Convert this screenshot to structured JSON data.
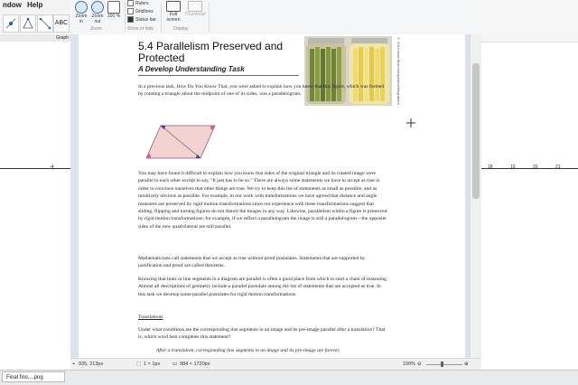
{
  "geo_left": {
    "menu": [
      "ndow",
      "Help"
    ],
    "tool_abc": "ABC",
    "panel_header": "Graph"
  },
  "paint": {
    "ribbon": {
      "zoom_in": "Zoom in",
      "zoom_out": "Zoom out",
      "percent": "100 %",
      "zoom_group": "Zoom",
      "rulers": "Rulers",
      "gridlines": "Gridlines",
      "status_bar": "Status bar",
      "show_hide_group": "Show or hide",
      "full_screen": "Full screen",
      "thumbnail": "Thumbnail",
      "display_group": "Display"
    },
    "status": {
      "cursor_pos": "935, 213px",
      "selection_size": "1 × 1px",
      "image_size": "984 × 1720px",
      "zoom": "100%"
    }
  },
  "document": {
    "title": "5.4 Parallelism Preserved and Protected",
    "subtitle": "A Develop Understanding Task",
    "photo_credit": "© 2013 www.flickr.com/photos/thegrabers",
    "paragraphs": [
      "In a previous task, How Do You Know That, you were asked to explain how you knew that this figure, which was formed by rotating a triangle about the midpoint of one of its sides, was a parallelogram.",
      "You may have found it difficult to explain how you know that sides of the original triangle and its rotated image were parallel to each other except to say, \"It just has to be so.\" There are always some statements we have to accept as true in order to convince ourselves that other things are true. We try to keep this list of statements as small as possible, and as intuitively obvious as possible. For example, in our work with transformations we have agreed that distance and angle measures are preserved by rigid motion transformations since our experience with these transformations suggest that sliding, flipping and turning figures do not distort the images in any way. Likewise, parallelism within a figure is preserved by rigid motion transformations: for example, if we reflect a parallelogram the image is still a parallelogram—the opposite sides of the new quadrilateral are still parallel.",
      "Mathematicians call statements that we accept as true without proof postulates. Statements that are supported by justification and proof are called theorems.",
      "Knowing that lines or line segments in a diagram are parallel is often a good place from which to start a chain of reasoning. Almost all descriptions of geometry include a parallel postulate among the list of statements that are accepted as true. In this task we develop some parallel postulates for rigid motion transformations.",
      "Translations",
      "Under what conditions are the corresponding line segments in an image and its pre-image parallel after a translation? That is, which word best completes this statement?",
      "After a translation, corresponding line segments in an image and its pre-image are forever,"
    ]
  },
  "geo_right": {
    "ticks": [
      "18",
      "19",
      "20",
      "21"
    ]
  },
  "taskbar": {
    "item": "Final fins....png"
  },
  "geo_left_tick": "-4"
}
